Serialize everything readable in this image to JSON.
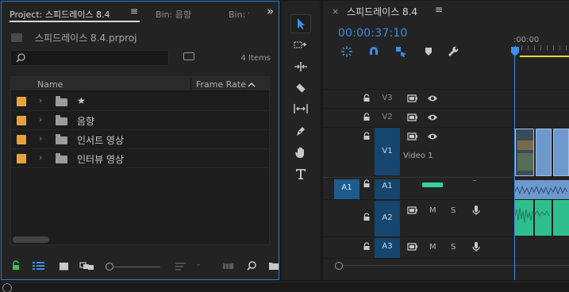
{
  "project": {
    "tabs": {
      "project": "Project: 스피드레이스 8.4",
      "menu": "≡",
      "bin1": "Bin: 음향",
      "bin2": "Bin: 인",
      "more": "»"
    },
    "file_name": "스피드레이스 8.4.prproj",
    "search_placeholder": "",
    "item_count": "4 Items",
    "columns": {
      "name": "Name",
      "frame_rate": "Frame Rate"
    },
    "items": [
      {
        "label": "★",
        "color": "#e8a23c"
      },
      {
        "label": "음향",
        "color": "#e8a23c"
      },
      {
        "label": "인서트 영상",
        "color": "#e8a23c"
      },
      {
        "label": "인터뷰 영상",
        "color": "#e8a23c"
      }
    ],
    "toolbar": [
      "lock-icon",
      "list-view-icon",
      "icon-view-icon",
      "freeform-view-icon",
      "zoom-slider",
      "sort-icon",
      "automate-icon",
      "find-icon",
      "new-bin-icon"
    ]
  },
  "tools": [
    "selection-tool-icon",
    "track-select-tool-icon",
    "ripple-edit-tool-icon",
    "razor-tool-icon",
    "slip-tool-icon",
    "pen-tool-icon",
    "hand-tool-icon",
    "type-tool-icon"
  ],
  "timeline": {
    "close": "×",
    "title": "스피드레이스 8.4",
    "menu": "≡",
    "timecode": "00:00:37:10",
    "ruler_label": ":00:00",
    "source_patch": "A1",
    "tracks": [
      {
        "name": "V3",
        "type": "video"
      },
      {
        "name": "V2",
        "type": "video"
      },
      {
        "name": "V1",
        "type": "video",
        "label": "Video 1"
      },
      {
        "name": "A1",
        "type": "audio"
      },
      {
        "name": "A2",
        "type": "audio",
        "m": "M",
        "s": "S"
      },
      {
        "name": "A3",
        "type": "audio",
        "m": "M",
        "s": "S"
      }
    ]
  },
  "colors": {
    "accent": "#3d8ee8",
    "label_orange": "#e8a23c",
    "audio_green": "#35d29a",
    "video_blue": "#6e99cd"
  }
}
